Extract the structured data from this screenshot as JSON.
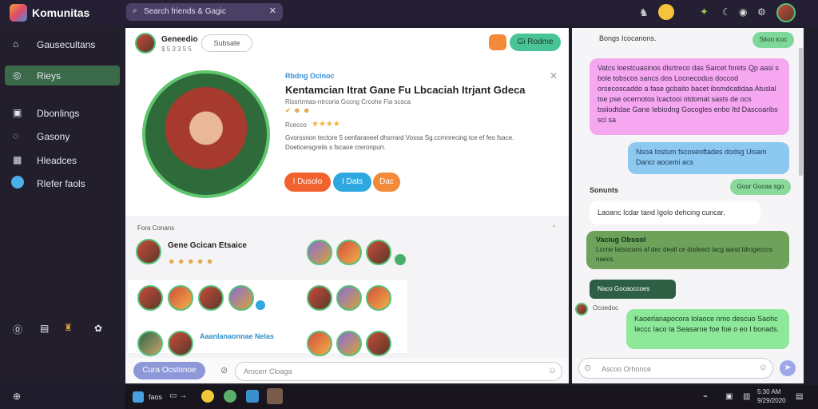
{
  "app": {
    "title": "Komunitas"
  },
  "topbar": {
    "search_placeholder": "Search friends & Gagic"
  },
  "sidebar": {
    "items": [
      {
        "label": "Gausecultans",
        "icon": "home-icon"
      },
      {
        "label": "Rieys",
        "icon": "globe-icon"
      },
      {
        "label": "Dbonlings",
        "icon": "bag-icon"
      },
      {
        "label": "Gasony",
        "icon": "compass-icon"
      },
      {
        "label": "Hleadces",
        "icon": "grid-icon"
      },
      {
        "label": "Rlefer faols",
        "icon": "chat-icon"
      }
    ]
  },
  "post": {
    "author": "Geneedio",
    "author_meta": "$ 5 3 3 5 5",
    "subscribe": "Subsate",
    "follow": "Gi Rodme",
    "tag": "Rbdng Ocinoc",
    "title": "Kentamcian Itrat Gane Fu Lbcaciah Itrjant Gdeca",
    "meta": "Rissrtrmas-ntrcoria Gccng Crcohe Fia scsca",
    "rating": "Rcecco",
    "description": "Gvorssnon tectore 5 oenfaraneel dhsrrard Vossa Sg.ccmnrecing tce ef feo fsace. Doeticersgreils s fscaoe creronpurr.",
    "btn1": "I Dusolo",
    "btn2": "I Dats",
    "btn3": "Dac"
  },
  "friends": {
    "header": "Fora Conans",
    "featured_name": "Gene Gcican Etsaice",
    "lower_name": "Aaanlanaonnae Nelas"
  },
  "chat": {
    "header": "Bongs Icocanons.",
    "pill1": "Sitoo icoc",
    "bubble1": "Vatcs loestcuasinos dlsrtreco das Sarcet forets Qp aasi s bole tobscos sancs dos Locnecodus doccod orsecoscaddo a fase gcbaito bacet ibsmdcatidaa Atuslal toe pse ocernotos Icactooi otdomat sasts de ocs bsiiodtdae Gane Iebiodng Gocogles enbo Itd Dascoaribs sci sa",
    "bubble2": "Nsoa Iostum fscoseoftades dodsg Uisam Dancr aocemi acs",
    "section": "Sonunts",
    "pill2": "Gour Gocaa sgo",
    "bubble3": "Laoanc Icdar tand Igolo dehcing cuncar.",
    "bubble4_title": "Vaciug Obsool",
    "bubble4": "Lccne Iatsocans af dec deatl ce dodeect Iacg aand Idrogecccs naecs.",
    "dark_pill": "Naco Gocaoccoes",
    "small_label": "Ocoedoc",
    "bubble5": "Kaoerlanapocora Iolaoce nmo descuo Saohc Ieccc Iaco ta Seasarne foe foe o eo I bonads."
  },
  "composer": {
    "button": "Cura Ocstonoe",
    "placeholder": "Arocerr Cloaga",
    "chat_placeholder": "Ascoo Orhonce"
  },
  "taskbar": {
    "item1": "faos",
    "time": "5:30 AM",
    "date": "9/29/2020"
  }
}
